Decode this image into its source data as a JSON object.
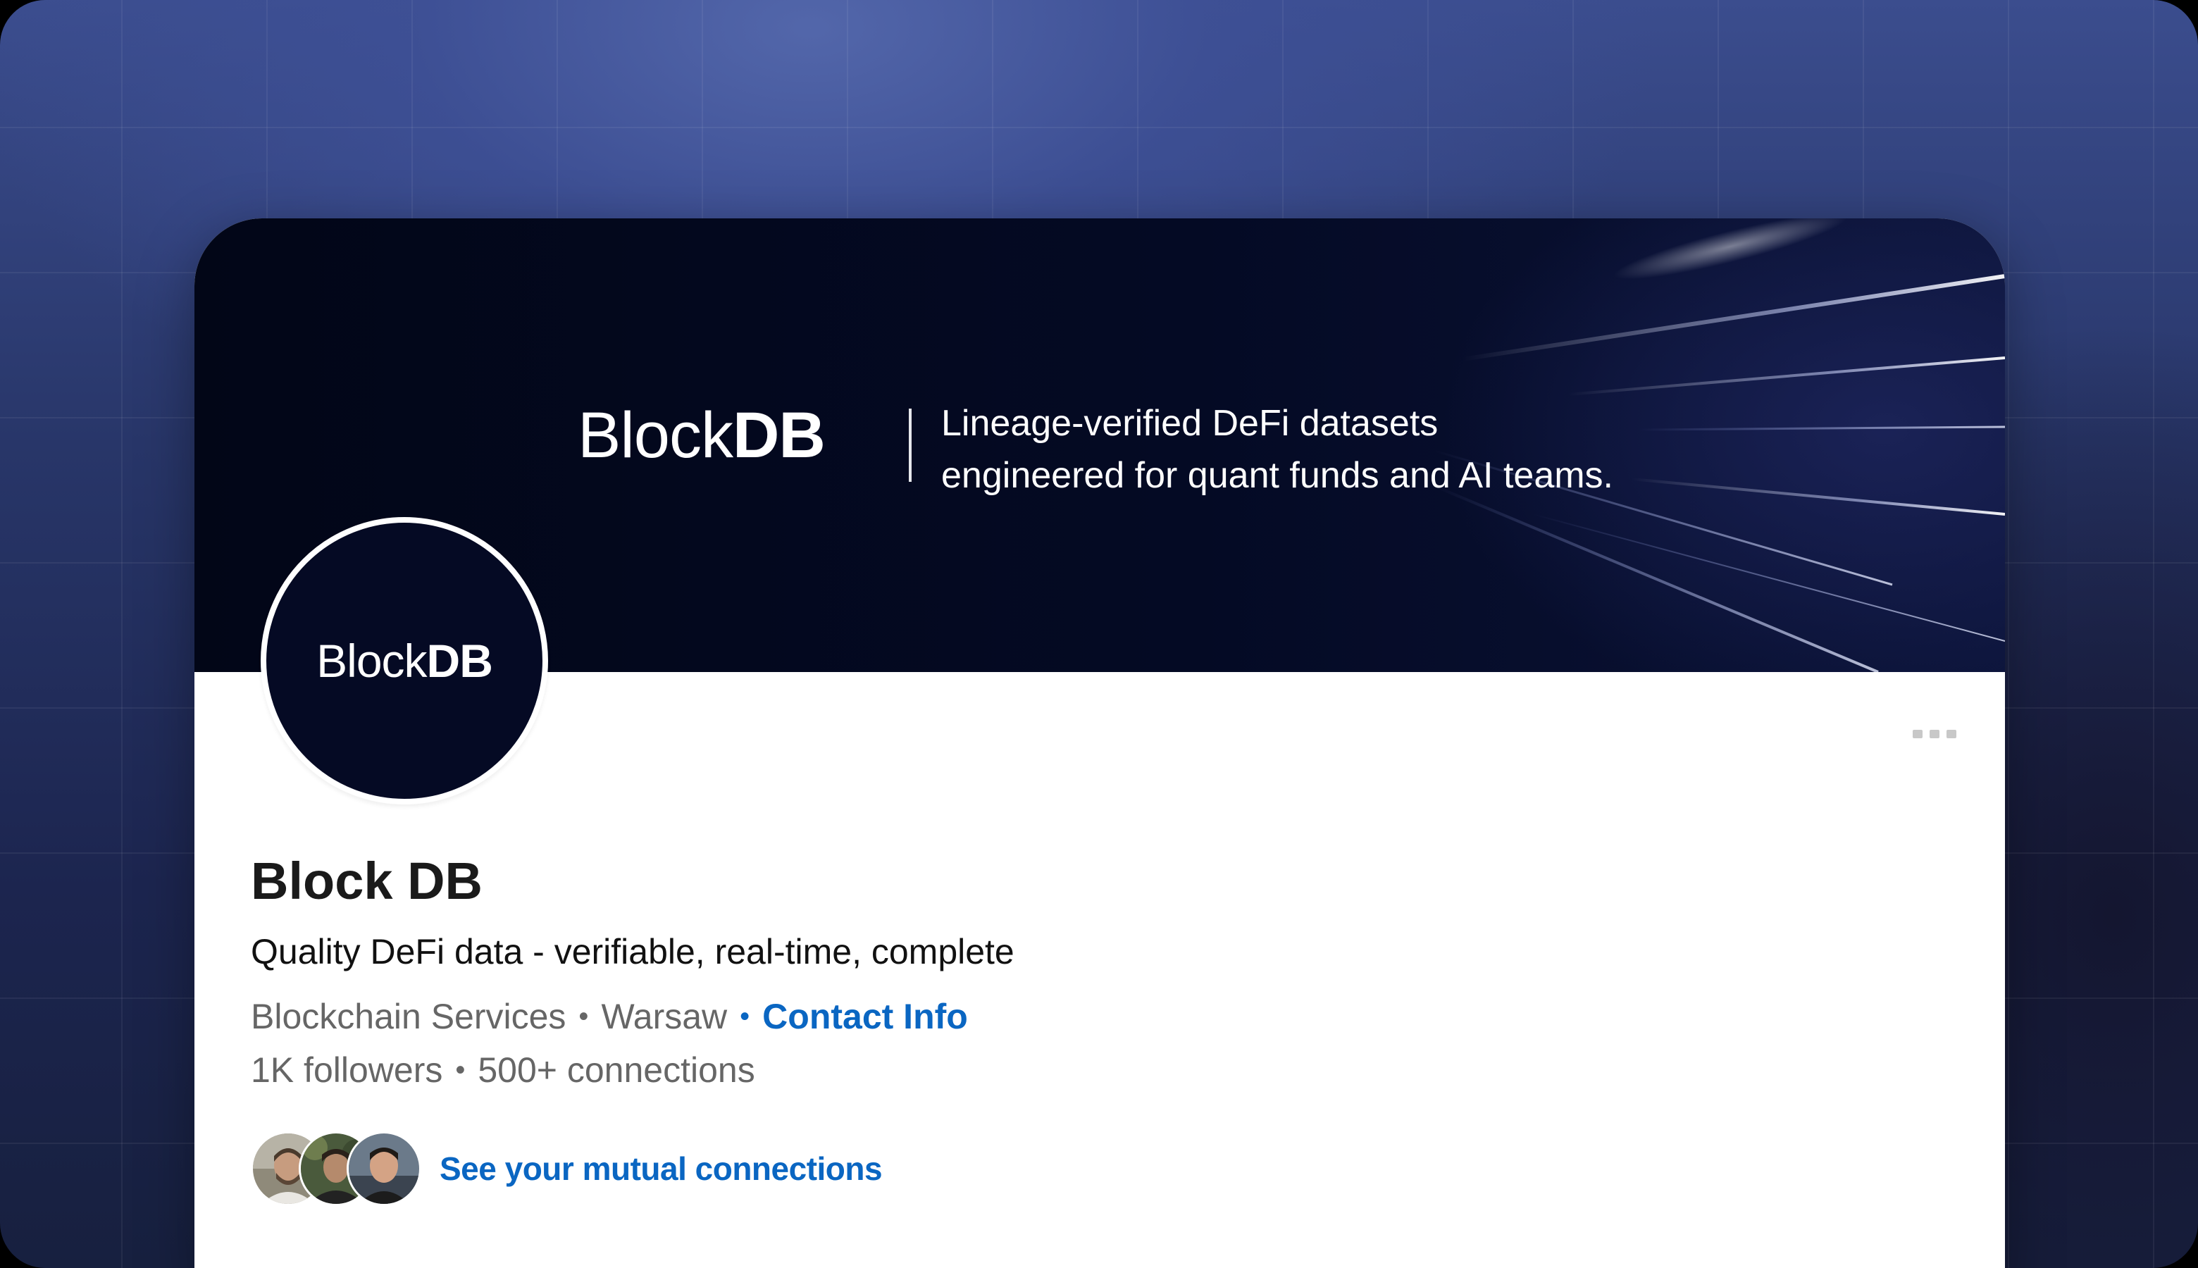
{
  "banner": {
    "logo_light": "Block",
    "logo_bold": "DB",
    "tagline_line1": "Lineage-verified DeFi datasets",
    "tagline_line2": "engineered for quant funds and AI teams."
  },
  "avatar": {
    "logo_light": "Block",
    "logo_bold": "DB"
  },
  "profile": {
    "name": "Block DB",
    "tagline": "Quality DeFi data - verifiable, real-time, complete",
    "industry": "Blockchain Services",
    "location": "Warsaw",
    "contact_label": "Contact Info",
    "followers": "1K followers",
    "connections": "500+ connections",
    "mutual_label": "See your mutual connections"
  },
  "icons": {
    "more": "more-horizontal-icon",
    "mutual_avatars": [
      "avatar-person-1",
      "avatar-person-2",
      "avatar-person-3"
    ]
  },
  "colors": {
    "accent": "#0a66c2",
    "banner_bg": "#020617",
    "text_primary": "#1a1a1a",
    "text_secondary": "#666666"
  }
}
